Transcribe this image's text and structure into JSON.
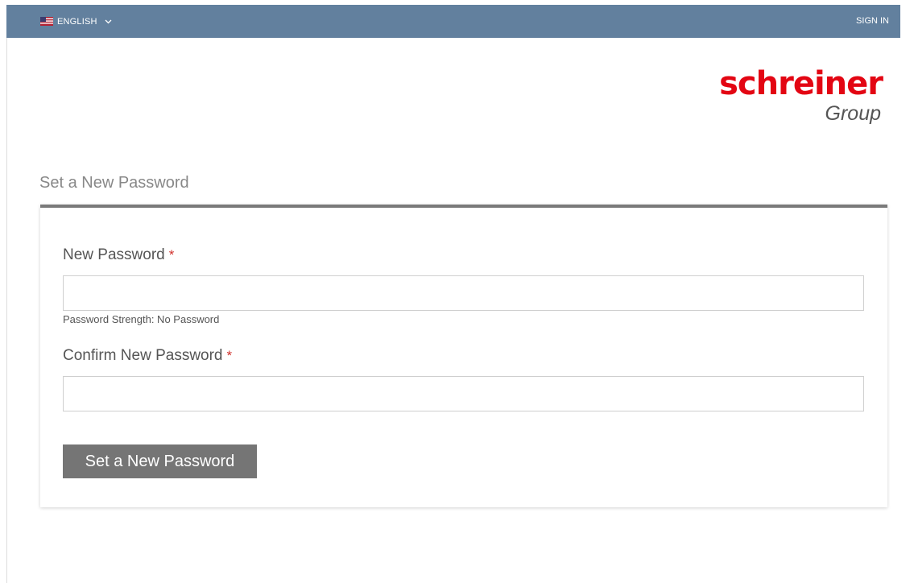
{
  "header": {
    "language": "ENGLISH",
    "signin": "SIGN IN"
  },
  "logo": {
    "line1": "schreiner",
    "line2": "Group"
  },
  "page": {
    "heading": "Set a New Password"
  },
  "form": {
    "new_password_label": "New Password",
    "confirm_password_label": "Confirm New Password",
    "required_mark": "*",
    "new_password_value": "",
    "confirm_password_value": "",
    "strength_text": "Password Strength: No Password",
    "submit_label": "Set a New Password"
  },
  "colors": {
    "header_bg": "#62809e",
    "brand_red": "#e30613",
    "button_bg": "#757575",
    "required": "#d0302b"
  },
  "icons": {
    "flag": "us-flag-icon",
    "chevron": "chevron-down-icon"
  }
}
